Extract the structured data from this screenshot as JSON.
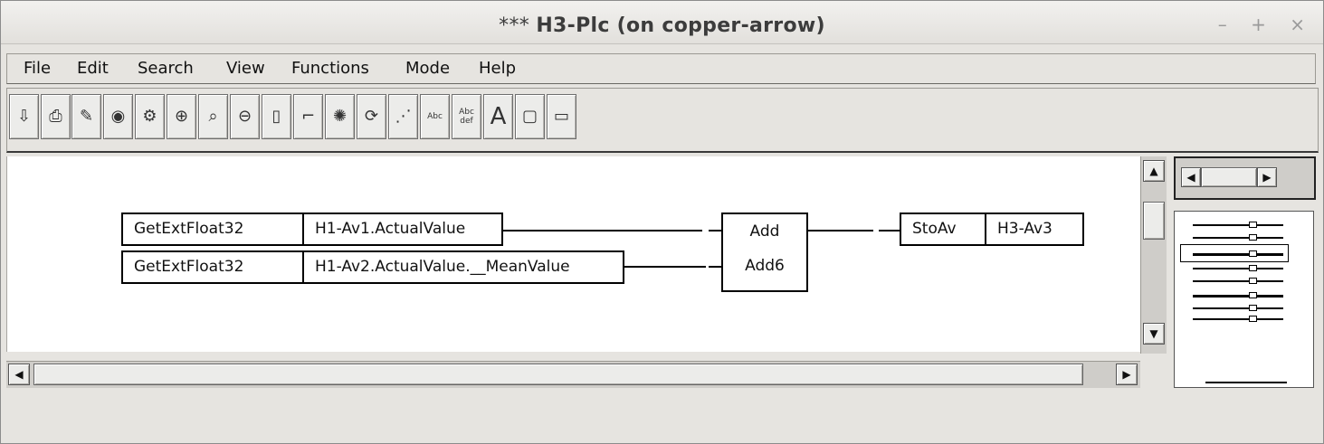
{
  "window": {
    "title_prefix": "***",
    "title_name": "H3-Plc (on copper-arrow)"
  },
  "wm": {
    "minimize": "–",
    "maximize": "+",
    "close": "×"
  },
  "menu": [
    "File",
    "Edit",
    "Search",
    "View",
    "Functions",
    "Mode",
    "Help"
  ],
  "toolbar": {
    "items": [
      {
        "name": "save-icon",
        "glyph": "⇩"
      },
      {
        "name": "print-icon",
        "glyph": "⎙"
      },
      {
        "name": "edit-pencil-icon",
        "glyph": "✎"
      },
      {
        "name": "view-eye-icon",
        "glyph": "◉"
      },
      {
        "name": "build-gear-icon",
        "glyph": "⚙"
      },
      {
        "name": "zoom-in-icon",
        "glyph": "⊕"
      },
      {
        "name": "zoom-icon",
        "glyph": "⌕"
      },
      {
        "name": "zoom-reset-icon",
        "glyph": "⊖"
      },
      {
        "name": "object-icon",
        "glyph": "▯"
      },
      {
        "name": "connect-icon",
        "glyph": "⌐"
      },
      {
        "name": "redraw-icon",
        "glyph": "✺"
      },
      {
        "name": "refresh-icon",
        "glyph": "⟳"
      },
      {
        "name": "grid-icon",
        "glyph": "⋰"
      },
      {
        "name": "text-small-icon",
        "text": "Abc"
      },
      {
        "name": "text-two-line-icon",
        "text": "Abc def"
      },
      {
        "name": "text-large-icon",
        "glyph": "A"
      },
      {
        "name": "document-icon",
        "glyph": "▢"
      },
      {
        "name": "window-icon",
        "glyph": "▭"
      }
    ]
  },
  "diagram": {
    "row1": {
      "func": "GetExtFloat32",
      "signal": "H1-Av1.ActualValue"
    },
    "row2": {
      "func": "GetExtFloat32",
      "signal": "H1-Av2.ActualValue.__MeanValue"
    },
    "add": {
      "label1": "Add",
      "label2": "Add6"
    },
    "out": {
      "func": "StoAv",
      "signal": "H3-Av3"
    }
  },
  "scroll": {
    "up": "▲",
    "down": "▼",
    "left": "◀",
    "right": "▶"
  }
}
